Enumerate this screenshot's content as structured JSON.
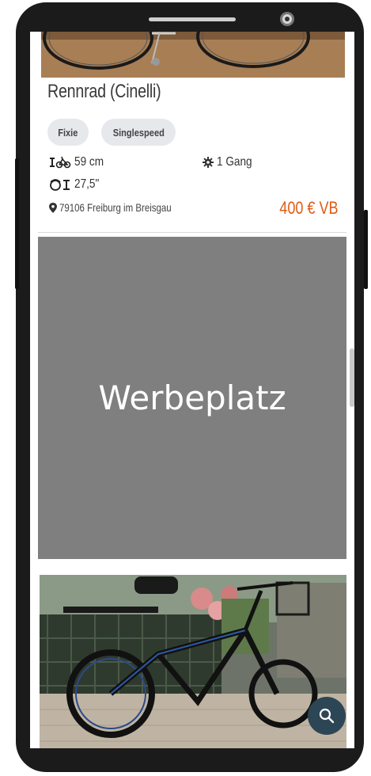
{
  "listing": {
    "title": "Rennrad (Cinelli)",
    "tags": [
      "Fixie",
      "Singlespeed"
    ],
    "frame_size": "59 cm",
    "gears": "1 Gang",
    "wheel_size": "27,5\"",
    "location": "79106 Freiburg im Breisgau",
    "price": "400 € VB"
  },
  "ad": {
    "label": "Werbeplatz"
  },
  "icons": {
    "frame": "frame-size-icon",
    "gear": "gear-icon",
    "wheel": "wheel-size-icon",
    "location": "map-pin-icon",
    "search": "search-icon"
  },
  "colors": {
    "price": "#e05a14",
    "ad_background": "#7f7f7f",
    "fab": "#2d4656",
    "tag_background": "#e6e8ec"
  }
}
